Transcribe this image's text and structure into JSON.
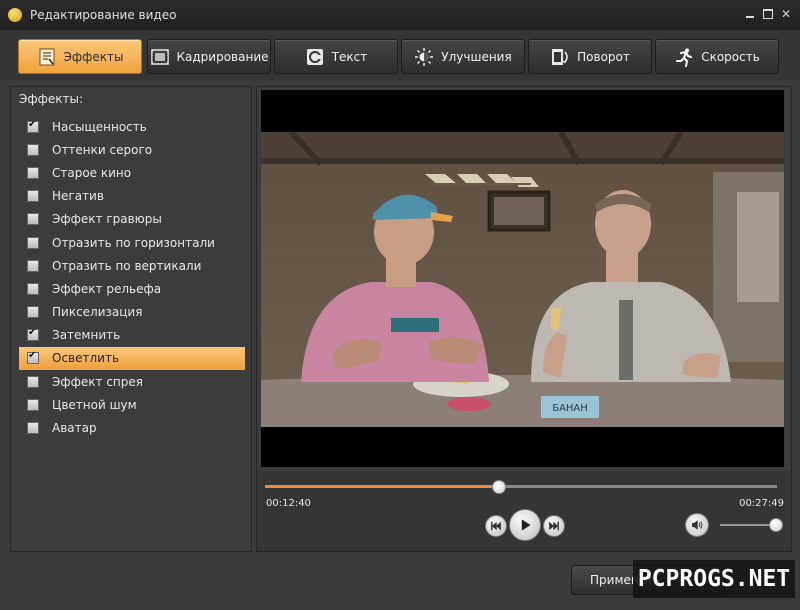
{
  "window": {
    "title": "Редактирование видео"
  },
  "tabs": [
    {
      "label": "Эффекты",
      "icon": "effects-icon",
      "active": true
    },
    {
      "label": "Кадрирование",
      "icon": "crop-icon",
      "active": false
    },
    {
      "label": "Текст",
      "icon": "text-icon",
      "active": false
    },
    {
      "label": "Улучшения",
      "icon": "brightness-icon",
      "active": false
    },
    {
      "label": "Поворот",
      "icon": "rotate-icon",
      "active": false
    },
    {
      "label": "Скорость",
      "icon": "speed-icon",
      "active": false
    }
  ],
  "effects_panel": {
    "title": "Эффекты:",
    "items": [
      {
        "label": "Насыщенность",
        "checked": true,
        "selected": false
      },
      {
        "label": "Оттенки серого",
        "checked": false,
        "selected": false
      },
      {
        "label": "Старое кино",
        "checked": false,
        "selected": false
      },
      {
        "label": "Негатив",
        "checked": false,
        "selected": false
      },
      {
        "label": "Эффект гравюры",
        "checked": false,
        "selected": false
      },
      {
        "label": "Отразить по горизонтали",
        "checked": false,
        "selected": false
      },
      {
        "label": "Отразить по вертикали",
        "checked": false,
        "selected": false
      },
      {
        "label": "Эффект рельефа",
        "checked": false,
        "selected": false
      },
      {
        "label": "Пикселизация",
        "checked": false,
        "selected": false
      },
      {
        "label": "Затемнить",
        "checked": true,
        "selected": false
      },
      {
        "label": "Осветлить",
        "checked": true,
        "selected": true
      },
      {
        "label": "Эффект спрея",
        "checked": false,
        "selected": false
      },
      {
        "label": "Цветной шум",
        "checked": false,
        "selected": false
      },
      {
        "label": "Аватар",
        "checked": false,
        "selected": false
      }
    ]
  },
  "player": {
    "current_time": "00:12:40",
    "total_time": "00:27:49",
    "progress": 0.455,
    "volume": 1.0,
    "scene_sign": "БАНАН"
  },
  "footer": {
    "apply_label": "Применить"
  },
  "watermark": {
    "text": "PCPROGS.NET"
  },
  "colors": {
    "accent": "#f0a33e",
    "progress": "#f08a3a"
  }
}
